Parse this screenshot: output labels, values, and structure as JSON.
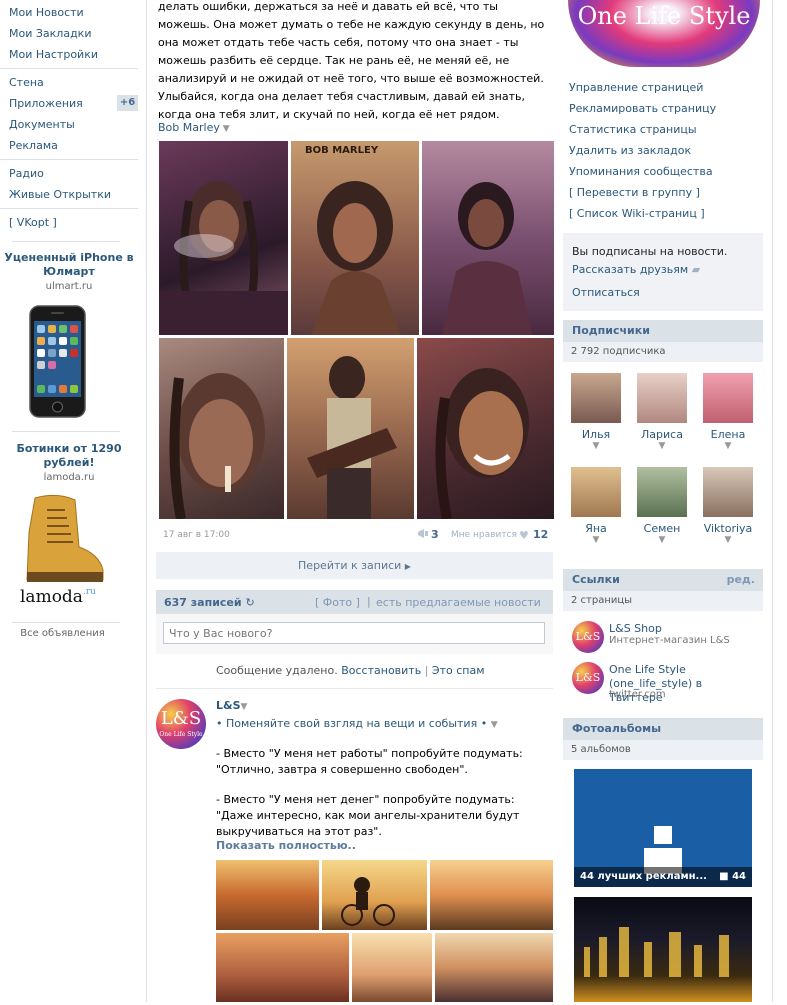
{
  "leftnav": {
    "items_top": [
      "Мои Новости",
      "Мои Закладки",
      "Мои Настройки"
    ],
    "items_mid": [
      "Стена",
      "Приложения",
      "Документы",
      "Реклама"
    ],
    "apps_badge": "+6",
    "items_bot": [
      "Радио",
      "Живые Открытки"
    ],
    "vkopt": "[ VKopt ]",
    "ad1": {
      "title": "Уцененный iPhone в Юлмарт",
      "domain": "ulmart.ru"
    },
    "ad2": {
      "title": "Ботинки от 1290 рублей!",
      "domain": "lamoda.ru",
      "brand": "lamoda",
      "brand_suffix": ".ru"
    },
    "all_ads": "Все объявления"
  },
  "post": {
    "text": "делать ошибки, держаться за неё и давать ей всё, что ты можешь. Она может думать о тебе не каждую секунду в день, но она может отдать тебе часть себя, потому что она знает - ты можешь разбить её сердце. Так не рань её, не меняй её, не анализируй и не ожидай от неё того, что выше её возможностей. Улыбайся, когда она делает тебя счастливым, давай ей знать, когда она тебя злит, и скучай по ней, когда её нет рядом.",
    "tag": "Bob Marley",
    "poster_text": "BOB MARLEY",
    "date": "17 авг в 17:00",
    "shares": "3",
    "like_label": "Мне нравится",
    "likes": "12",
    "goto": "Перейти к записи"
  },
  "wall": {
    "count": "637 записей",
    "photo_link": "[ Фото ]",
    "sep": "|",
    "suggested": "есть предлагаемые новости",
    "input_placeholder": "Что у Вас нового?",
    "deleted": "Сообщение удалено.",
    "restore": "Восстановить",
    "spam": "Это спам"
  },
  "post2": {
    "author": "L&S",
    "avatar_text": "L&S",
    "avatar_sub": "One Life Style",
    "subtitle": "• Поменяйте свой взгляд на вещи и события •",
    "line1": "- Вместо \"У меня нет работы\" попробуйте подумать:",
    "line2": "\"Отлично, завтра я совершенно свободен\".",
    "line3": "- Вместо \"У меня нет денег\" попробуйте подумать: \"Даже интересно, как мои ангелы-хранители будут выкручиваться на этот раз\".",
    "show_more": "Показать полностью.."
  },
  "right": {
    "cover_text": "One Life Style",
    "links": [
      "Управление страницей",
      "Рекламировать страницу",
      "Статистика страницы",
      "Удалить из закладок",
      "Упоминания сообщества",
      "[ Перевести в группу ]",
      "[ Список Wiki-страниц ]"
    ],
    "subscribed": "Вы подписаны на новости.",
    "tell_friends": "Рассказать друзьям",
    "unsubscribe": "Отписаться",
    "followers_title": "Подписчики",
    "followers_count": "2 792 подписчика",
    "members": [
      "Илья",
      "Лариса",
      "Елена",
      "Яна",
      "Семен",
      "Viktoriya"
    ],
    "links_title": "Ссылки",
    "links_edit": "ред.",
    "links_count": "2 страницы",
    "link1": {
      "title": "L&S Shop",
      "desc": "Интернет-магазин L&S"
    },
    "link2": {
      "title": "One Life Style (one_life_style) в Твиттере",
      "desc": "twitter.com"
    },
    "albums_title": "Фотоальбомы",
    "albums_count": "5 альбомов",
    "album1": {
      "label": "44 лучших рекламн...",
      "count": "44"
    }
  }
}
